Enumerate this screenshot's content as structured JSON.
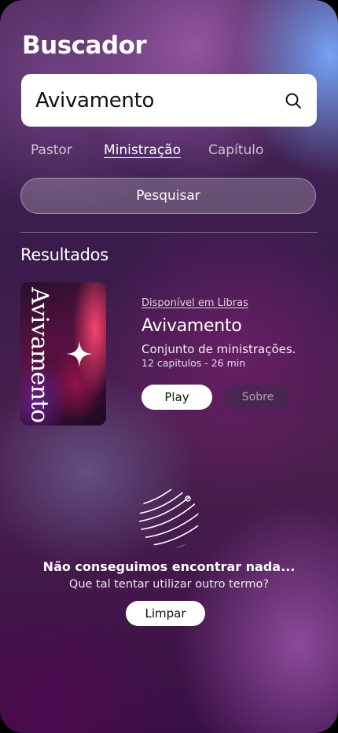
{
  "header": {
    "title": "Buscador"
  },
  "search": {
    "value": "Avivamento",
    "icon": "search-icon"
  },
  "tabs": [
    {
      "label": "Pastor",
      "active": false
    },
    {
      "label": "Ministração",
      "active": true
    },
    {
      "label": "Capítulo",
      "active": false
    }
  ],
  "search_button": {
    "label": "Pesquisar"
  },
  "results": {
    "heading": "Resultados",
    "items": [
      {
        "cover_text": "Avivamento",
        "badge": "Disponível em Libras",
        "title": "Avivamento",
        "description": "Conjunto de ministrações.",
        "meta": "12 capitulos - 26 min",
        "play_label": "Play",
        "about_label": "Sobre"
      }
    ]
  },
  "empty_state": {
    "icon": "globe-icon",
    "title": "Não conseguimos encontrar nada...",
    "subtitle": "Que tal tentar utilizar outro termo?",
    "button_label": "Limpar"
  },
  "colors": {
    "background_dark": "#3a1c4c",
    "accent_pink": "#ff4670",
    "button_light": "#ffffff"
  }
}
